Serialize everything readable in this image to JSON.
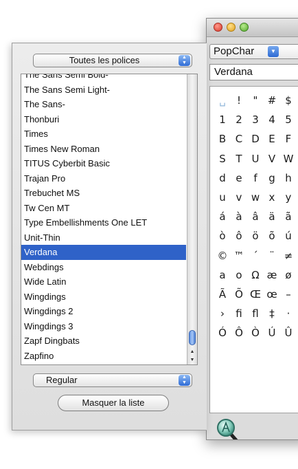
{
  "popchar": {
    "app_selector": "PopChar",
    "current_font": "Verdana",
    "characters": [
      "␣",
      "!",
      "\"",
      "#",
      "$",
      "1",
      "2",
      "3",
      "4",
      "5",
      "B",
      "C",
      "D",
      "E",
      "F",
      "S",
      "T",
      "U",
      "V",
      "W",
      "d",
      "e",
      "f",
      "g",
      "h",
      "u",
      "v",
      "w",
      "x",
      "y",
      "á",
      "à",
      "â",
      "ä",
      "ã",
      "ò",
      "ô",
      "ö",
      "õ",
      "ú",
      "©",
      "™",
      "´",
      "¨",
      "≠",
      "a",
      "o",
      "Ω",
      "æ",
      "ø",
      "Ã",
      "Õ",
      "Œ",
      "œ",
      "–",
      "›",
      "fi",
      "fl",
      "‡",
      "·",
      "Ó",
      "Ô",
      "Ò",
      "Ú",
      "Û"
    ]
  },
  "drawer": {
    "collection_popup": "Toutes les polices",
    "fonts": [
      "The Sans Semi Bold-",
      "The Sans Semi Light-",
      "The Sans-",
      "Thonburi",
      "Times",
      "Times New Roman",
      "TITUS Cyberbit Basic",
      "Trajan Pro",
      "Trebuchet MS",
      "Tw Cen MT",
      "Type Embellishments One LET",
      "Unit-Thin",
      "Verdana",
      "Webdings",
      "Wide Latin",
      "Wingdings",
      "Wingdings 2",
      "Wingdings 3",
      "Zapf Dingbats",
      "Zapfino"
    ],
    "selected_font": "Verdana",
    "style_popup": "Regular",
    "hide_list_button": "Masquer la liste"
  },
  "colors": {
    "selection": "#2f62c8",
    "accent_blue": "#2f6cd6"
  }
}
